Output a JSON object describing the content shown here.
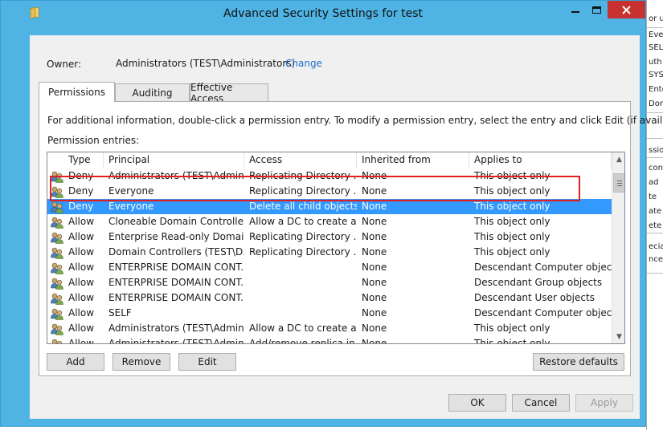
{
  "window": {
    "title": "Advanced Security Settings for test"
  },
  "owner": {
    "label": "Owner:",
    "value": "Administrators (TEST\\Administrators)",
    "change_link": "Change"
  },
  "tabs": [
    {
      "label": "Permissions",
      "active": true
    },
    {
      "label": "Auditing",
      "active": false
    },
    {
      "label": "Effective Access",
      "active": false
    }
  ],
  "info_text": "For additional information, double-click a permission entry. To modify a permission entry, select the entry and click Edit (if available).",
  "entries_label": "Permission entries:",
  "columns": [
    "Type",
    "Principal",
    "Access",
    "Inherited from",
    "Applies to"
  ],
  "rows": [
    {
      "type": "Deny",
      "principal": "Administrators (TEST\\Admin...",
      "access": "Replicating Directory ...",
      "inherited": "None",
      "applies": "This object only"
    },
    {
      "type": "Deny",
      "principal": "Everyone",
      "access": "Replicating Directory ...",
      "inherited": "None",
      "applies": "This object only"
    },
    {
      "type": "Deny",
      "principal": "Everyone",
      "access": "Delete all child objects",
      "inherited": "None",
      "applies": "This object only",
      "selected": true
    },
    {
      "type": "Allow",
      "principal": "Cloneable Domain Controller...",
      "access": "Allow a DC to create a ...",
      "inherited": "None",
      "applies": "This object only"
    },
    {
      "type": "Allow",
      "principal": "Enterprise Read-only Domain...",
      "access": "Replicating Directory ...",
      "inherited": "None",
      "applies": "This object only"
    },
    {
      "type": "Allow",
      "principal": "Domain Controllers (TEST\\D...",
      "access": "Replicating Directory ...",
      "inherited": "None",
      "applies": "This object only"
    },
    {
      "type": "Allow",
      "principal": "ENTERPRISE DOMAIN CONT...",
      "access": "",
      "inherited": "None",
      "applies": "Descendant Computer objects"
    },
    {
      "type": "Allow",
      "principal": "ENTERPRISE DOMAIN CONT...",
      "access": "",
      "inherited": "None",
      "applies": "Descendant Group objects"
    },
    {
      "type": "Allow",
      "principal": "ENTERPRISE DOMAIN CONT...",
      "access": "",
      "inherited": "None",
      "applies": "Descendant User objects"
    },
    {
      "type": "Allow",
      "principal": "SELF",
      "access": "",
      "inherited": "None",
      "applies": "Descendant Computer objects"
    },
    {
      "type": "Allow",
      "principal": "Administrators (TEST\\Admin...",
      "access": "Allow a DC to create a ...",
      "inherited": "None",
      "applies": "This object only"
    },
    {
      "type": "Allow",
      "principal": "Administrators (TEST\\Admin...",
      "access": "Add/remove replica in ...",
      "inherited": "None",
      "applies": "This object only"
    }
  ],
  "buttons": {
    "add": "Add",
    "remove": "Remove",
    "edit": "Edit",
    "restore": "Restore defaults",
    "ok": "OK",
    "cancel": "Cancel",
    "apply": "Apply"
  },
  "background_window_fragments": [
    "or u",
    "Ever",
    "SELF",
    "uth",
    "SYST",
    "Ente",
    "Dom",
    "ssion",
    "conf",
    "ad",
    "te",
    "ate",
    "ete",
    "ecia",
    "nced"
  ],
  "colors": {
    "title_bar": "#4fb3e4",
    "close_button": "#c7312f",
    "selection": "#3399ff",
    "link": "#1a6fc9",
    "annotation": "#e02020"
  }
}
